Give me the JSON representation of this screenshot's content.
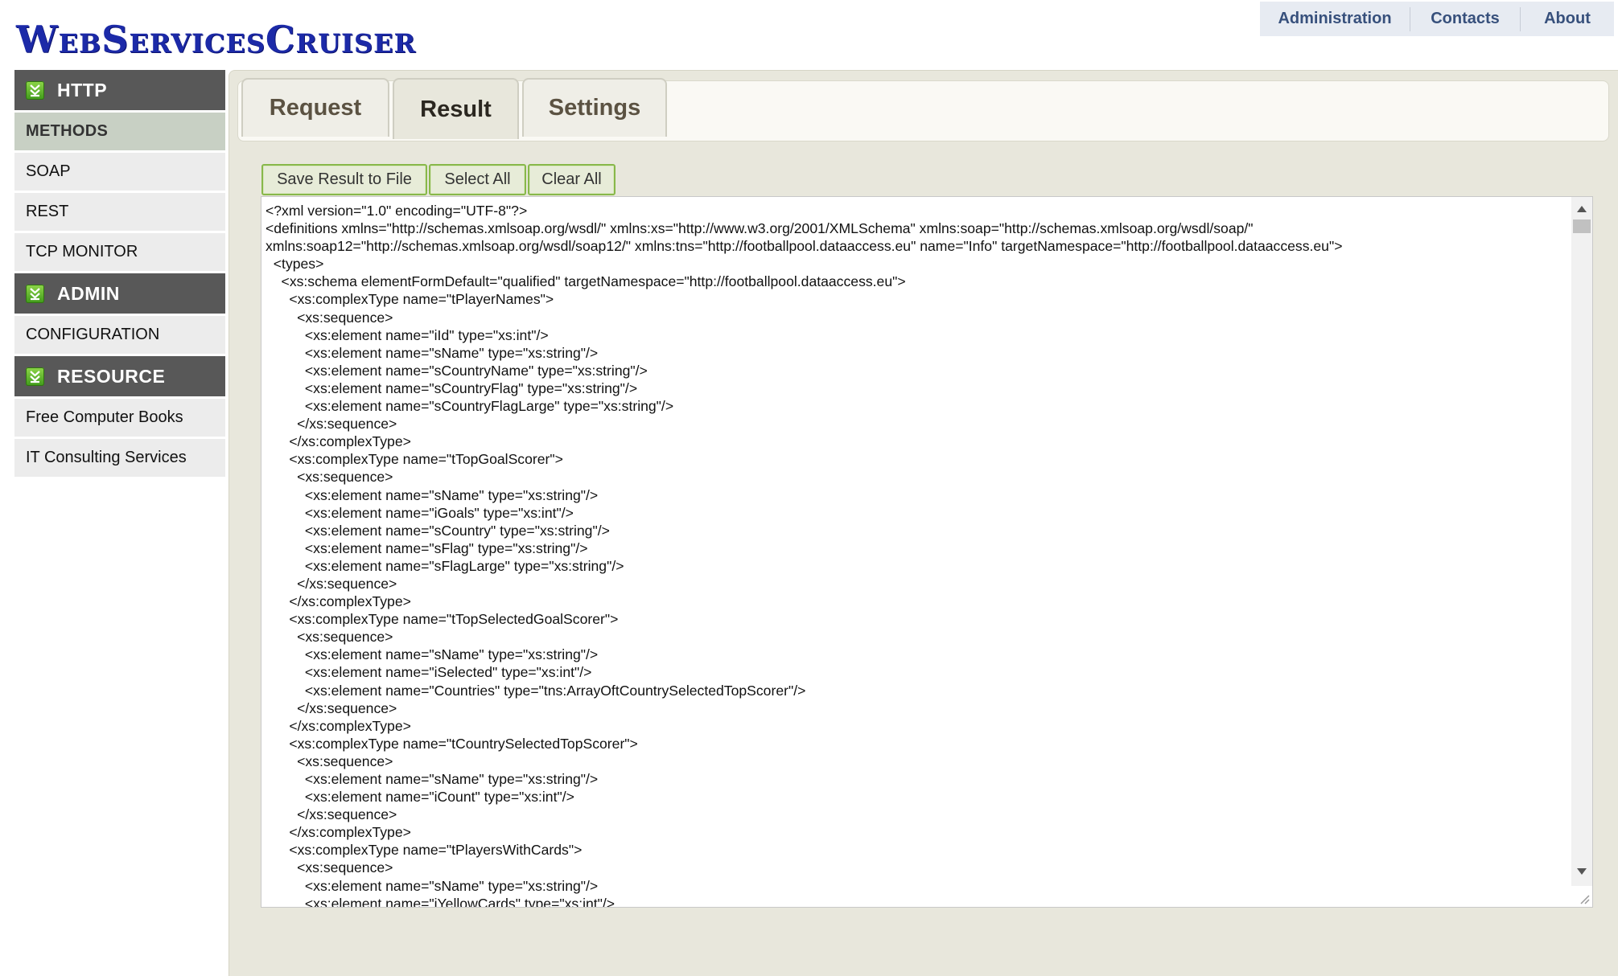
{
  "app": {
    "logo": "WebServicesCruiser"
  },
  "topnav": {
    "items": [
      "Administration",
      "Contacts",
      "About"
    ]
  },
  "sidebar": {
    "http_header": "HTTP",
    "http_items": [
      "METHODS",
      "SOAP",
      "REST",
      "TCP MONITOR"
    ],
    "admin_header": "ADMIN",
    "admin_items": [
      "CONFIGURATION"
    ],
    "resource_header": "RESOURCE",
    "resource_items": [
      "Free Computer Books",
      "IT Consulting Services"
    ],
    "active_item": "METHODS"
  },
  "tabs": {
    "request": "Request",
    "result": "Result",
    "settings": "Settings",
    "active": "Result"
  },
  "toolbar": {
    "save": "Save Result to File",
    "select_all": "Select All",
    "clear_all": "Clear All"
  },
  "result": {
    "content": "<?xml version=\"1.0\" encoding=\"UTF-8\"?>\n<definitions xmlns=\"http://schemas.xmlsoap.org/wsdl/\" xmlns:xs=\"http://www.w3.org/2001/XMLSchema\" xmlns:soap=\"http://schemas.xmlsoap.org/wsdl/soap/\"\nxmlns:soap12=\"http://schemas.xmlsoap.org/wsdl/soap12/\" xmlns:tns=\"http://footballpool.dataaccess.eu\" name=\"Info\" targetNamespace=\"http://footballpool.dataaccess.eu\">\n  <types>\n    <xs:schema elementFormDefault=\"qualified\" targetNamespace=\"http://footballpool.dataaccess.eu\">\n      <xs:complexType name=\"tPlayerNames\">\n        <xs:sequence>\n          <xs:element name=\"iId\" type=\"xs:int\"/>\n          <xs:element name=\"sName\" type=\"xs:string\"/>\n          <xs:element name=\"sCountryName\" type=\"xs:string\"/>\n          <xs:element name=\"sCountryFlag\" type=\"xs:string\"/>\n          <xs:element name=\"sCountryFlagLarge\" type=\"xs:string\"/>\n        </xs:sequence>\n      </xs:complexType>\n      <xs:complexType name=\"tTopGoalScorer\">\n        <xs:sequence>\n          <xs:element name=\"sName\" type=\"xs:string\"/>\n          <xs:element name=\"iGoals\" type=\"xs:int\"/>\n          <xs:element name=\"sCountry\" type=\"xs:string\"/>\n          <xs:element name=\"sFlag\" type=\"xs:string\"/>\n          <xs:element name=\"sFlagLarge\" type=\"xs:string\"/>\n        </xs:sequence>\n      </xs:complexType>\n      <xs:complexType name=\"tTopSelectedGoalScorer\">\n        <xs:sequence>\n          <xs:element name=\"sName\" type=\"xs:string\"/>\n          <xs:element name=\"iSelected\" type=\"xs:int\"/>\n          <xs:element name=\"Countries\" type=\"tns:ArrayOftCountrySelectedTopScorer\"/>\n        </xs:sequence>\n      </xs:complexType>\n      <xs:complexType name=\"tCountrySelectedTopScorer\">\n        <xs:sequence>\n          <xs:element name=\"sName\" type=\"xs:string\"/>\n          <xs:element name=\"iCount\" type=\"xs:int\"/>\n        </xs:sequence>\n      </xs:complexType>\n      <xs:complexType name=\"tPlayersWithCards\">\n        <xs:sequence>\n          <xs:element name=\"sName\" type=\"xs:string\"/>\n          <xs:element name=\"iYellowCards\" type=\"xs:int\"/>"
  },
  "colors": {
    "logo": "#1c2aa8",
    "nav_text": "#37507c",
    "sidebar_header": "#585858",
    "active_item": "#c8d0c4",
    "button_border": "#88b84a",
    "panel": "#e8e7dc"
  }
}
